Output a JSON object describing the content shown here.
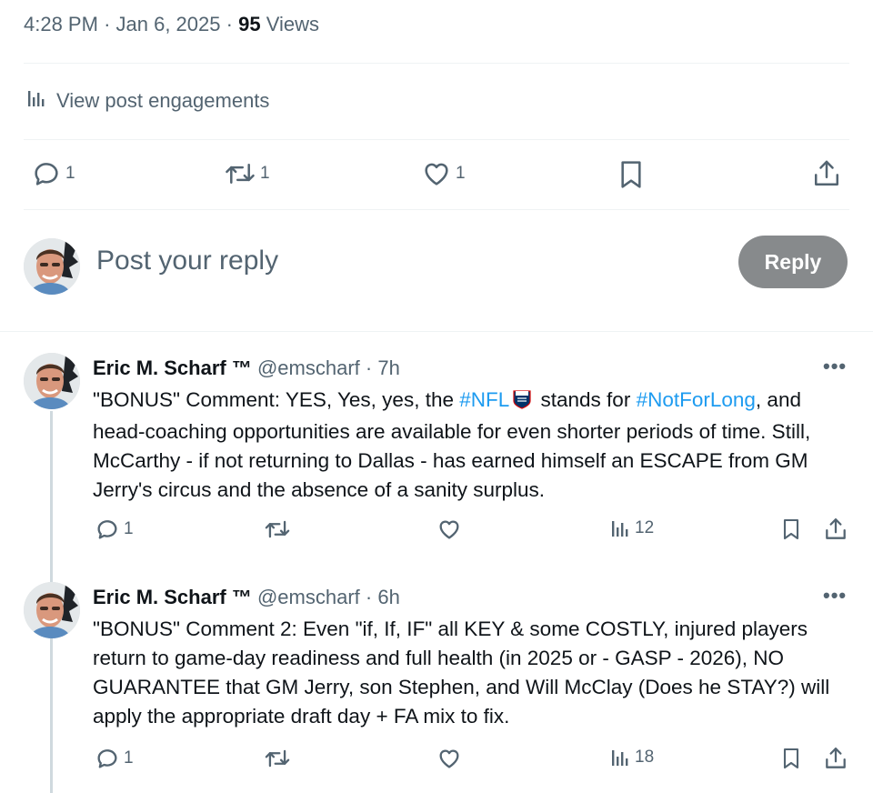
{
  "post_meta": {
    "time": "4:28 PM",
    "sep1": "·",
    "date": "Jan 6, 2025",
    "sep2": "·",
    "views_count": "95",
    "views_label": "Views"
  },
  "engagements_link": "View post engagements",
  "main_actions": {
    "replies": "1",
    "reposts": "1",
    "likes": "1"
  },
  "reply_composer": {
    "placeholder": "Post your reply",
    "button_label": "Reply"
  },
  "replies": [
    {
      "name": "Eric M. Scharf ™",
      "handle": "@emscharf",
      "sep": "·",
      "age": "7h",
      "text_1": "\"BONUS\" Comment: YES, Yes, yes, the ",
      "hashtag_1": "#NFL",
      "text_2": " stands for ",
      "hashtag_2": "#NotForLong",
      "text_3": ", and head-coaching opportunities are available for even shorter periods of time. Still, McCarthy - if not returning to Dallas - has earned himself an ESCAPE from GM Jerry's circus and the absence of a sanity surplus.",
      "reply_count": "1",
      "view_count": "12"
    },
    {
      "name": "Eric M. Scharf ™",
      "handle": "@emscharf",
      "sep": "·",
      "age": "6h",
      "text": "\"BONUS\" Comment 2: Even \"if, If, IF\" all KEY & some COSTLY, injured players return to game-day readiness and full health (in 2025 or - GASP - 2026), NO GUARANTEE that GM Jerry, son Stephen, and Will McClay (Does he STAY?) will apply the appropriate draft day + FA mix to fix.",
      "reply_count": "1",
      "view_count": "18"
    }
  ],
  "icons": [
    "analytics-icon",
    "reply-icon",
    "repost-icon",
    "like-icon",
    "bookmark-icon",
    "share-icon",
    "more-icon",
    "nfl-logo-icon"
  ],
  "colors": {
    "link": "#1d9bf0",
    "muted": "#536471",
    "reply_button": "#878a8c"
  }
}
